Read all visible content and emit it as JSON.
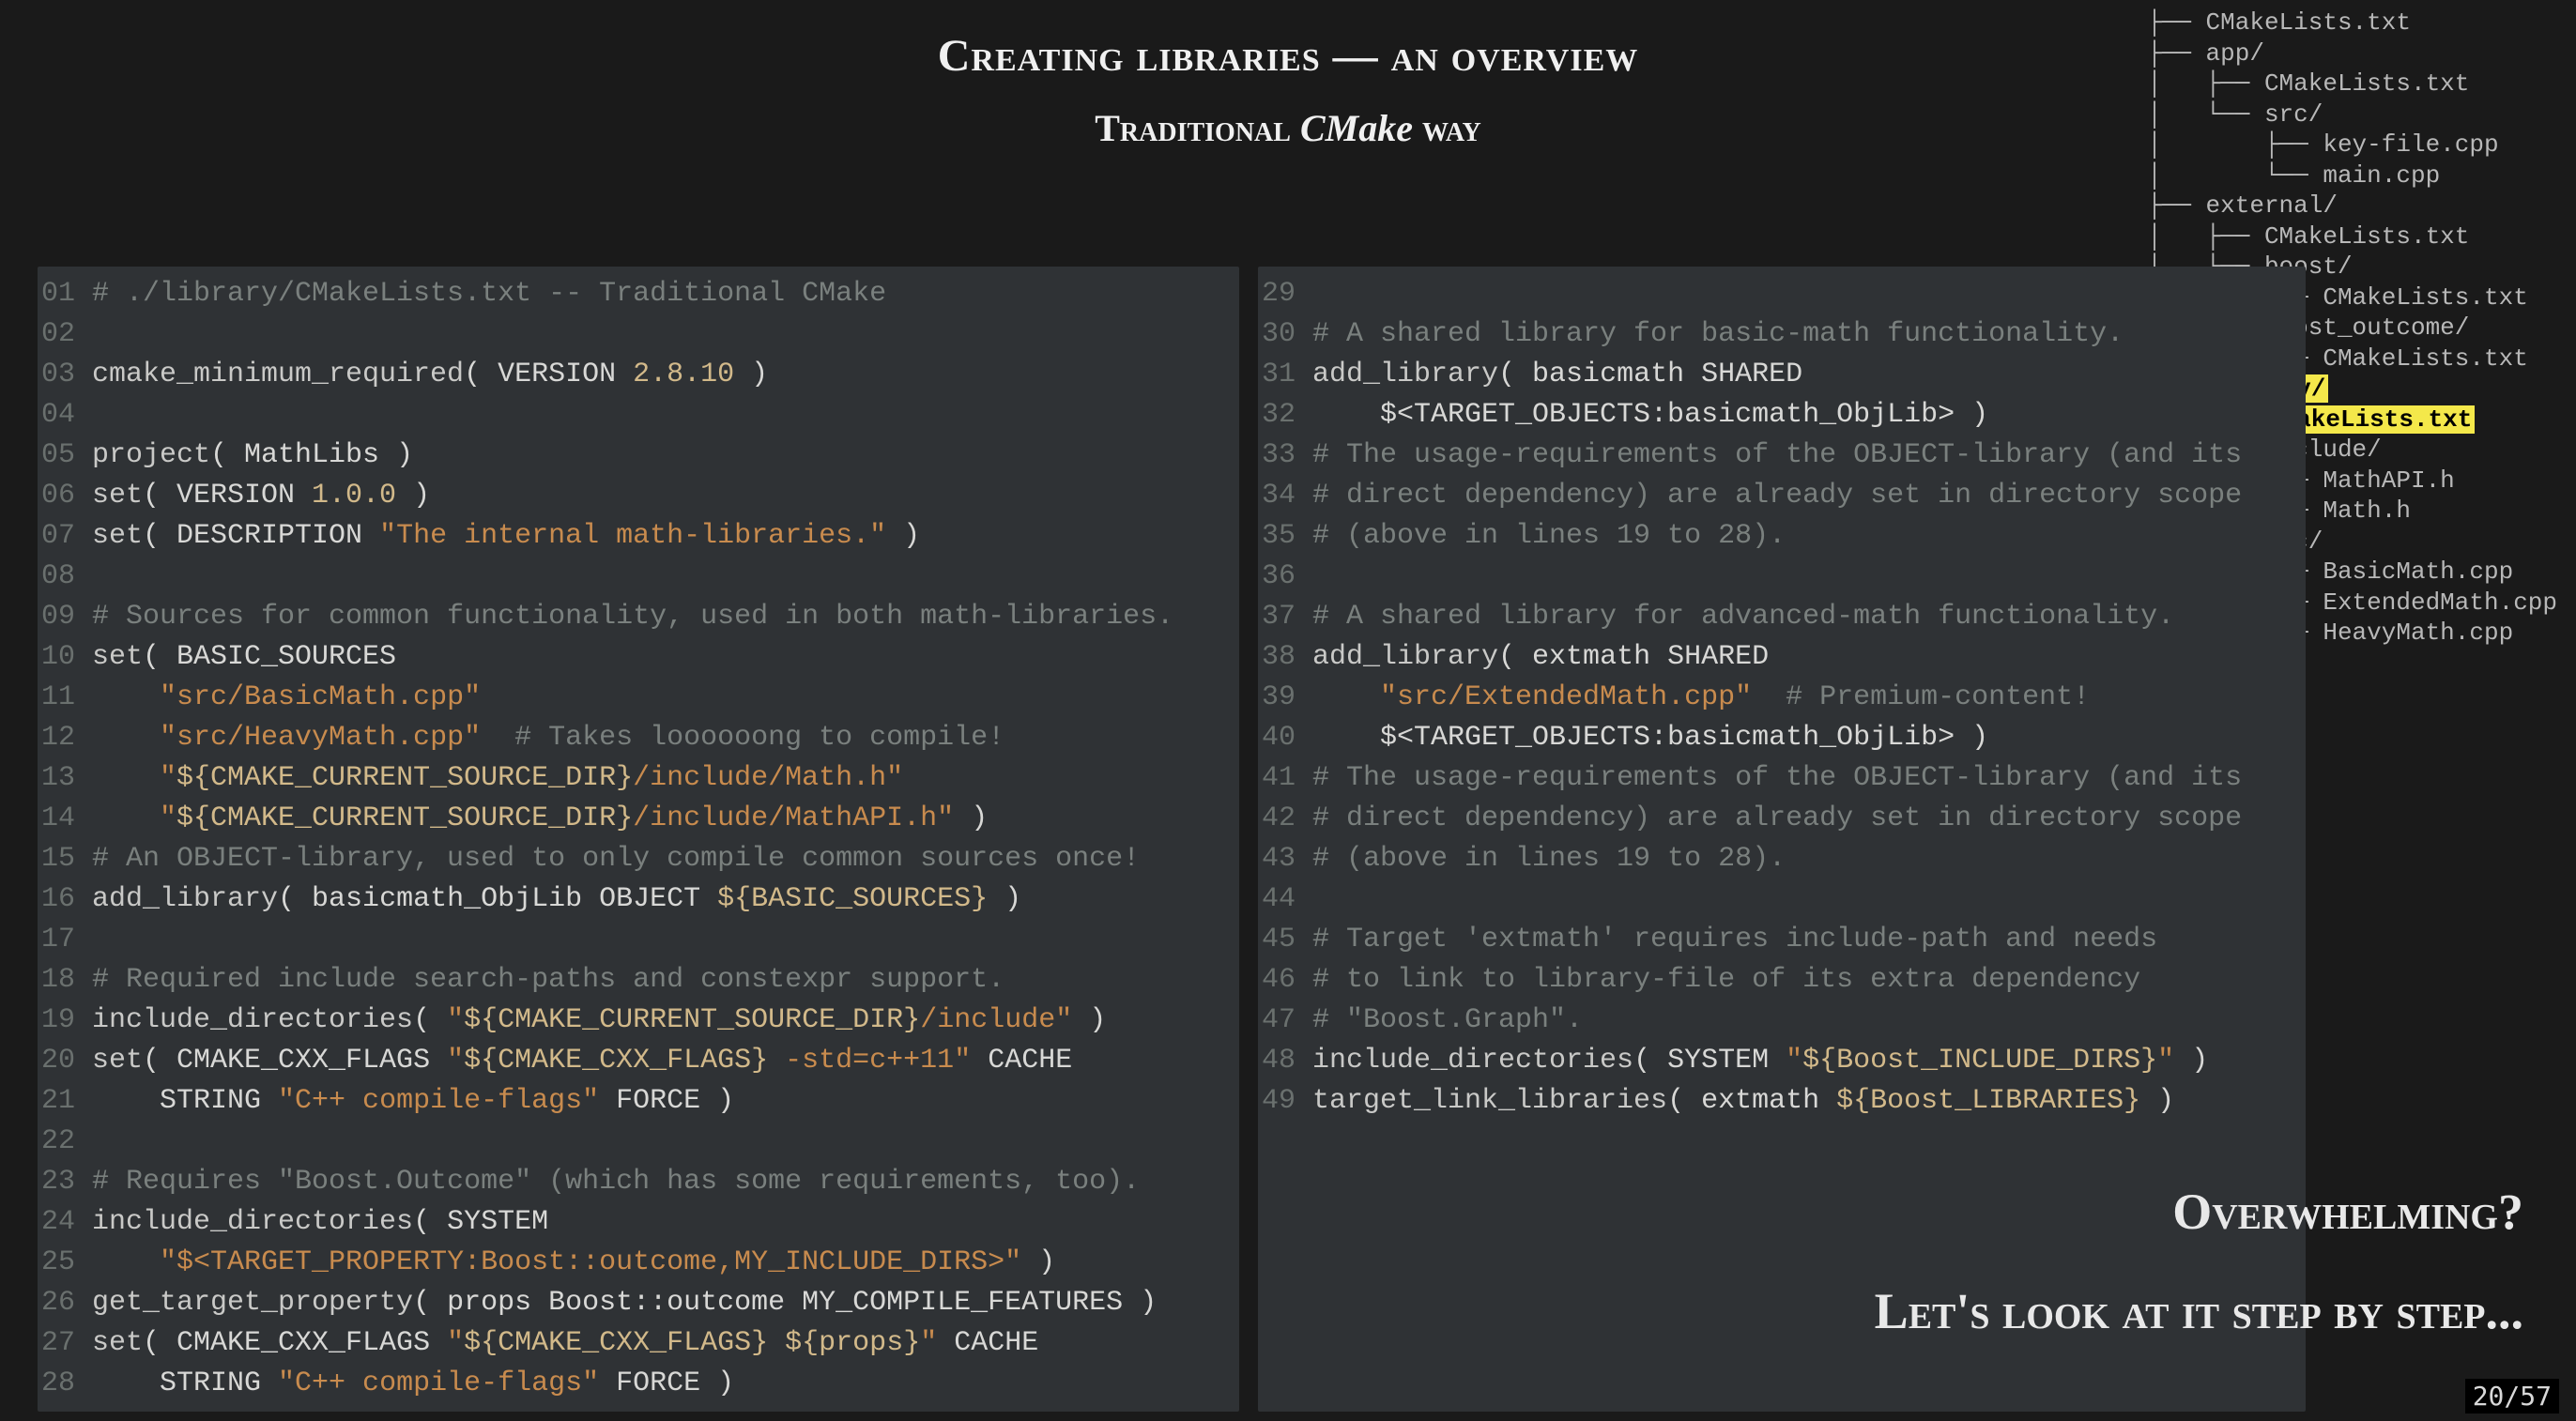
{
  "title": "Creating libraries — an overview",
  "subtitle_prefix": "Traditional ",
  "subtitle_em": "CMake",
  "subtitle_suffix": " way",
  "pagenum": "20/57",
  "overwhelm": {
    "line1": "Overwhelming?",
    "line2": "Let's look at it step by step..."
  },
  "tree": [
    "├── CMakeLists.txt",
    "├── app/",
    "│   ├── CMakeLists.txt",
    "│   └── src/",
    "│       ├── key-file.cpp",
    "│       └── main.cpp",
    "├── external/",
    "│   ├── CMakeLists.txt",
    "│   ├── boost/",
    "│   │   └── CMakeLists.txt",
    "│   └── boost_outcome/",
    "│       └── CMakeLists.txt",
    "└── ",
    "    ├── ",
    "    ├── include/",
    "    │   ├── MathAPI.h",
    "    │   └── Math.h",
    "    └── src/",
    "        ├── BasicMath.cpp",
    "        ├── ExtendedMath.cpp",
    "        └── HeavyMath.cpp"
  ],
  "tree_hl_dir": "library/",
  "tree_hl_file": "CMakeLists.txt",
  "code_left": [
    {
      "n": "01",
      "tokens": [
        {
          "t": "# ./library/CMakeLists.txt -- Traditional CMake",
          "c": "cm"
        }
      ]
    },
    {
      "n": "02",
      "tokens": []
    },
    {
      "n": "03",
      "tokens": [
        {
          "t": "cmake_minimum_required",
          "c": "fn"
        },
        {
          "t": "( ",
          "c": "code"
        },
        {
          "t": "VERSION ",
          "c": "kw"
        },
        {
          "t": "2.8.10",
          "c": "lit"
        },
        {
          "t": " )",
          "c": "code"
        }
      ]
    },
    {
      "n": "04",
      "tokens": []
    },
    {
      "n": "05",
      "tokens": [
        {
          "t": "project",
          "c": "fn"
        },
        {
          "t": "( MathLibs )",
          "c": "code"
        }
      ]
    },
    {
      "n": "06",
      "tokens": [
        {
          "t": "set",
          "c": "fn"
        },
        {
          "t": "( VERSION ",
          "c": "code"
        },
        {
          "t": "1.0.0",
          "c": "lit"
        },
        {
          "t": " )",
          "c": "code"
        }
      ]
    },
    {
      "n": "07",
      "tokens": [
        {
          "t": "set",
          "c": "fn"
        },
        {
          "t": "( DESCRIPTION ",
          "c": "code"
        },
        {
          "t": "\"The internal math-libraries.\"",
          "c": "str"
        },
        {
          "t": " )",
          "c": "code"
        }
      ]
    },
    {
      "n": "08",
      "tokens": []
    },
    {
      "n": "09",
      "tokens": [
        {
          "t": "# Sources for common functionality, used in both math-libraries.",
          "c": "cm"
        }
      ]
    },
    {
      "n": "10",
      "tokens": [
        {
          "t": "set",
          "c": "fn"
        },
        {
          "t": "( BASIC_SOURCES",
          "c": "code"
        }
      ]
    },
    {
      "n": "11",
      "tokens": [
        {
          "t": "    ",
          "c": "code"
        },
        {
          "t": "\"src/BasicMath.cpp\"",
          "c": "str"
        }
      ]
    },
    {
      "n": "12",
      "tokens": [
        {
          "t": "    ",
          "c": "code"
        },
        {
          "t": "\"src/HeavyMath.cpp\"",
          "c": "str"
        },
        {
          "t": "  ",
          "c": "code"
        },
        {
          "t": "# Takes loooooong to compile!",
          "c": "cm"
        }
      ]
    },
    {
      "n": "13",
      "tokens": [
        {
          "t": "    ",
          "c": "code"
        },
        {
          "t": "\"",
          "c": "str"
        },
        {
          "t": "${CMAKE_CURRENT_SOURCE_DIR}",
          "c": "var"
        },
        {
          "t": "/include/Math.h\"",
          "c": "str"
        }
      ]
    },
    {
      "n": "14",
      "tokens": [
        {
          "t": "    ",
          "c": "code"
        },
        {
          "t": "\"",
          "c": "str"
        },
        {
          "t": "${CMAKE_CURRENT_SOURCE_DIR}",
          "c": "var"
        },
        {
          "t": "/include/MathAPI.h\"",
          "c": "str"
        },
        {
          "t": " )",
          "c": "code"
        }
      ]
    },
    {
      "n": "15",
      "tokens": [
        {
          "t": "# An OBJECT-library, used to only compile common sources once!",
          "c": "cm"
        }
      ]
    },
    {
      "n": "16",
      "tokens": [
        {
          "t": "add_library",
          "c": "fn"
        },
        {
          "t": "( basicmath_ObjLib OBJECT ",
          "c": "code"
        },
        {
          "t": "${BASIC_SOURCES}",
          "c": "var"
        },
        {
          "t": " )",
          "c": "code"
        }
      ]
    },
    {
      "n": "17",
      "tokens": []
    },
    {
      "n": "18",
      "tokens": [
        {
          "t": "# Required include search-paths and constexpr support.",
          "c": "cm"
        }
      ]
    },
    {
      "n": "19",
      "tokens": [
        {
          "t": "include_directories",
          "c": "fn"
        },
        {
          "t": "( ",
          "c": "code"
        },
        {
          "t": "\"",
          "c": "str"
        },
        {
          "t": "${CMAKE_CURRENT_SOURCE_DIR}",
          "c": "var"
        },
        {
          "t": "/include\"",
          "c": "str"
        },
        {
          "t": " )",
          "c": "code"
        }
      ]
    },
    {
      "n": "20",
      "tokens": [
        {
          "t": "set",
          "c": "fn"
        },
        {
          "t": "( CMAKE_CXX_FLAGS ",
          "c": "code"
        },
        {
          "t": "\"",
          "c": "str"
        },
        {
          "t": "${CMAKE_CXX_FLAGS}",
          "c": "var"
        },
        {
          "t": " -std=c++11\"",
          "c": "str"
        },
        {
          "t": " CACHE",
          "c": "code"
        }
      ]
    },
    {
      "n": "21",
      "tokens": [
        {
          "t": "    STRING ",
          "c": "code"
        },
        {
          "t": "\"C++ compile-flags\"",
          "c": "str"
        },
        {
          "t": " FORCE )",
          "c": "code"
        }
      ]
    },
    {
      "n": "22",
      "tokens": []
    },
    {
      "n": "23",
      "tokens": [
        {
          "t": "# Requires \"Boost.Outcome\" (which has some requirements, too).",
          "c": "cm"
        }
      ]
    },
    {
      "n": "24",
      "tokens": [
        {
          "t": "include_directories",
          "c": "fn"
        },
        {
          "t": "( SYSTEM",
          "c": "code"
        }
      ]
    },
    {
      "n": "25",
      "tokens": [
        {
          "t": "    ",
          "c": "code"
        },
        {
          "t": "\"$<TARGET_PROPERTY:Boost::outcome,MY_INCLUDE_DIRS>\"",
          "c": "str"
        },
        {
          "t": " )",
          "c": "code"
        }
      ]
    },
    {
      "n": "26",
      "tokens": [
        {
          "t": "get_target_property",
          "c": "fn"
        },
        {
          "t": "( props Boost::outcome MY_COMPILE_FEATURES )",
          "c": "code"
        }
      ]
    },
    {
      "n": "27",
      "tokens": [
        {
          "t": "set",
          "c": "fn"
        },
        {
          "t": "( CMAKE_CXX_FLAGS ",
          "c": "code"
        },
        {
          "t": "\"",
          "c": "str"
        },
        {
          "t": "${CMAKE_CXX_FLAGS}",
          "c": "var"
        },
        {
          "t": " ",
          "c": "str"
        },
        {
          "t": "${props}",
          "c": "var"
        },
        {
          "t": "\"",
          "c": "str"
        },
        {
          "t": " CACHE",
          "c": "code"
        }
      ]
    },
    {
      "n": "28",
      "tokens": [
        {
          "t": "    STRING ",
          "c": "code"
        },
        {
          "t": "\"C++ compile-flags\"",
          "c": "str"
        },
        {
          "t": " FORCE )",
          "c": "code"
        }
      ]
    }
  ],
  "code_right": [
    {
      "n": "29",
      "tokens": []
    },
    {
      "n": "30",
      "tokens": [
        {
          "t": "# A shared library for basic-math functionality.",
          "c": "cm"
        }
      ]
    },
    {
      "n": "31",
      "tokens": [
        {
          "t": "add_library",
          "c": "fn"
        },
        {
          "t": "( basicmath SHARED",
          "c": "code"
        }
      ]
    },
    {
      "n": "32",
      "tokens": [
        {
          "t": "    $<TARGET_OBJECTS:basicmath_ObjLib> )",
          "c": "code"
        }
      ]
    },
    {
      "n": "33",
      "tokens": [
        {
          "t": "# The usage-requirements of the OBJECT-library (and its",
          "c": "cm"
        }
      ]
    },
    {
      "n": "34",
      "tokens": [
        {
          "t": "# direct dependency) are already set in directory scope",
          "c": "cm"
        }
      ]
    },
    {
      "n": "35",
      "tokens": [
        {
          "t": "# (above in lines 19 to 28).",
          "c": "cm"
        }
      ]
    },
    {
      "n": "36",
      "tokens": []
    },
    {
      "n": "37",
      "tokens": [
        {
          "t": "# A shared library for advanced-math functionality.",
          "c": "cm"
        }
      ]
    },
    {
      "n": "38",
      "tokens": [
        {
          "t": "add_library",
          "c": "fn"
        },
        {
          "t": "( extmath SHARED",
          "c": "code"
        }
      ]
    },
    {
      "n": "39",
      "tokens": [
        {
          "t": "    ",
          "c": "code"
        },
        {
          "t": "\"src/ExtendedMath.cpp\"",
          "c": "str"
        },
        {
          "t": "  ",
          "c": "code"
        },
        {
          "t": "# Premium-content!",
          "c": "cm"
        }
      ]
    },
    {
      "n": "40",
      "tokens": [
        {
          "t": "    $<TARGET_OBJECTS:basicmath_ObjLib> )",
          "c": "code"
        }
      ]
    },
    {
      "n": "41",
      "tokens": [
        {
          "t": "# The usage-requirements of the OBJECT-library (and its",
          "c": "cm"
        }
      ]
    },
    {
      "n": "42",
      "tokens": [
        {
          "t": "# direct dependency) are already set in directory scope",
          "c": "cm"
        }
      ]
    },
    {
      "n": "43",
      "tokens": [
        {
          "t": "# (above in lines 19 to 28).",
          "c": "cm"
        }
      ]
    },
    {
      "n": "44",
      "tokens": []
    },
    {
      "n": "45",
      "tokens": [
        {
          "t": "# Target 'extmath' requires include-path and needs",
          "c": "cm"
        }
      ]
    },
    {
      "n": "46",
      "tokens": [
        {
          "t": "# to link to library-file of its extra dependency",
          "c": "cm"
        }
      ]
    },
    {
      "n": "47",
      "tokens": [
        {
          "t": "# \"Boost.Graph\".",
          "c": "cm"
        }
      ]
    },
    {
      "n": "48",
      "tokens": [
        {
          "t": "include_directories",
          "c": "fn"
        },
        {
          "t": "( SYSTEM ",
          "c": "code"
        },
        {
          "t": "\"",
          "c": "str"
        },
        {
          "t": "${Boost_INCLUDE_DIRS}",
          "c": "var"
        },
        {
          "t": "\"",
          "c": "str"
        },
        {
          "t": " )",
          "c": "code"
        }
      ]
    },
    {
      "n": "49",
      "tokens": [
        {
          "t": "target_link_libraries",
          "c": "fn"
        },
        {
          "t": "( extmath ",
          "c": "code"
        },
        {
          "t": "${Boost_LIBRARIES}",
          "c": "var"
        },
        {
          "t": " )",
          "c": "code"
        }
      ]
    }
  ]
}
